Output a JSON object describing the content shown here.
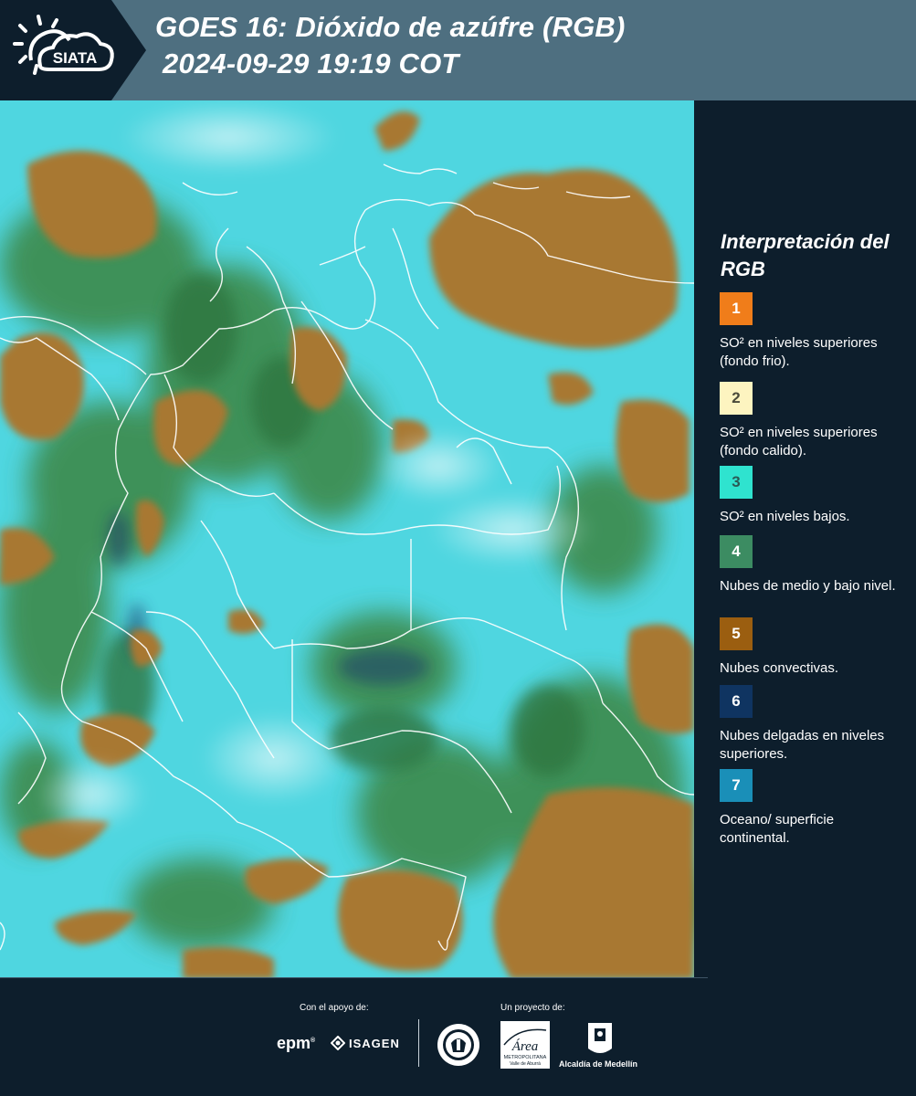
{
  "header": {
    "logo_text": "SIATA",
    "title_line1": "GOES 16: Dióxido de azúfre (RGB)",
    "title_line2": "2024-09-29 19:19 COT",
    "logo_icon": "sun-cloud-icon"
  },
  "map": {
    "description_icon": "satellite-rgb-map",
    "colors": {
      "ocean_cyan": "#4fd6e0",
      "low_cloud_green": "#3c8a4c",
      "convective_brown": "#a87832",
      "thin_blue": "#1b3b6b",
      "border_white": "#ffffff"
    }
  },
  "legend": {
    "title": "Interpretación del RGB",
    "items": [
      {
        "number": "1",
        "color": "#f07d1a",
        "text": "SO² en niveles superiores (fondo frio).",
        "num_color": "#ffffff"
      },
      {
        "number": "2",
        "color": "#fdf4c0",
        "text": "SO² en niveles superiores (fondo calido).",
        "num_color": "#4a4a3a"
      },
      {
        "number": "3",
        "color": "#2fe3cf",
        "text": "SO² en niveles bajos.",
        "num_color": "#2a5a55"
      },
      {
        "number": "4",
        "color": "#3c8c62",
        "text": "Nubes de medio y bajo nivel.",
        "num_color": "#ffffff"
      },
      {
        "number": "5",
        "color": "#9b5e10",
        "text": "Nubes convectivas.",
        "num_color": "#ffffff"
      },
      {
        "number": "6",
        "color": "#0f3461",
        "text": "Nubes delgadas en niveles superiores.",
        "num_color": "#ffffff"
      },
      {
        "number": "7",
        "color": "#1a8fb8",
        "text": "Oceano/ superficie continental.",
        "num_color": "#ffffff"
      }
    ]
  },
  "footer": {
    "support_label": "Con el apoyo de:",
    "project_label": "Un proyecto de:",
    "sponsor_epm": "epm",
    "sponsor_isagen": "ISAGEN",
    "area_name": "Área",
    "area_sub1": "METROPOLITANA",
    "area_sub2": "Valle de Aburrá",
    "alcaldia": "Alcaldía de Medellín",
    "seal_icon": "medellin-seal-icon",
    "area_icon": "area-metropolitana-logo",
    "alcaldia_icon": "alcaldia-shield-icon"
  }
}
